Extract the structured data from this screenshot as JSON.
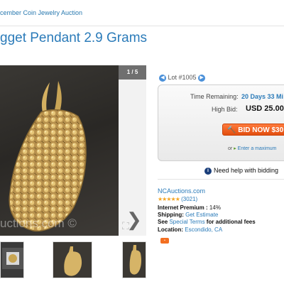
{
  "breadcrumb": "cember Coin Jewelry Auction",
  "title": "gget Pendant 2.9 Grams",
  "gallery": {
    "counter": "1 / 5",
    "watermark": "uctions.com ©"
  },
  "lot": {
    "label": "Lot #1005"
  },
  "bidding": {
    "time_label": "Time Remaining:",
    "time_value": "20 Days 33 Mi",
    "high_bid_label": "High Bid:",
    "high_bid_value": "USD 25.00",
    "bid_button": "BID NOW $30",
    "max_prefix": "or",
    "max_link": "Enter a maximum"
  },
  "help": {
    "text": "Need help with bidding"
  },
  "seller": {
    "name": "NCAuctions.com",
    "stars": "★★★★★",
    "rating_count": "(3021)",
    "premium_label": "Internet Premium :",
    "premium_value": "14%",
    "shipping_label": "Shipping:",
    "shipping_link": "Get Estimate",
    "terms_prefix": "See",
    "terms_link": "Special Terms",
    "terms_suffix": "for additional fees",
    "location_label": "Location:",
    "location_value": "Escondido, CA"
  },
  "colors": {
    "accent": "#2b7bb9",
    "bid_button": "#f36f21",
    "star": "#f5a623"
  }
}
